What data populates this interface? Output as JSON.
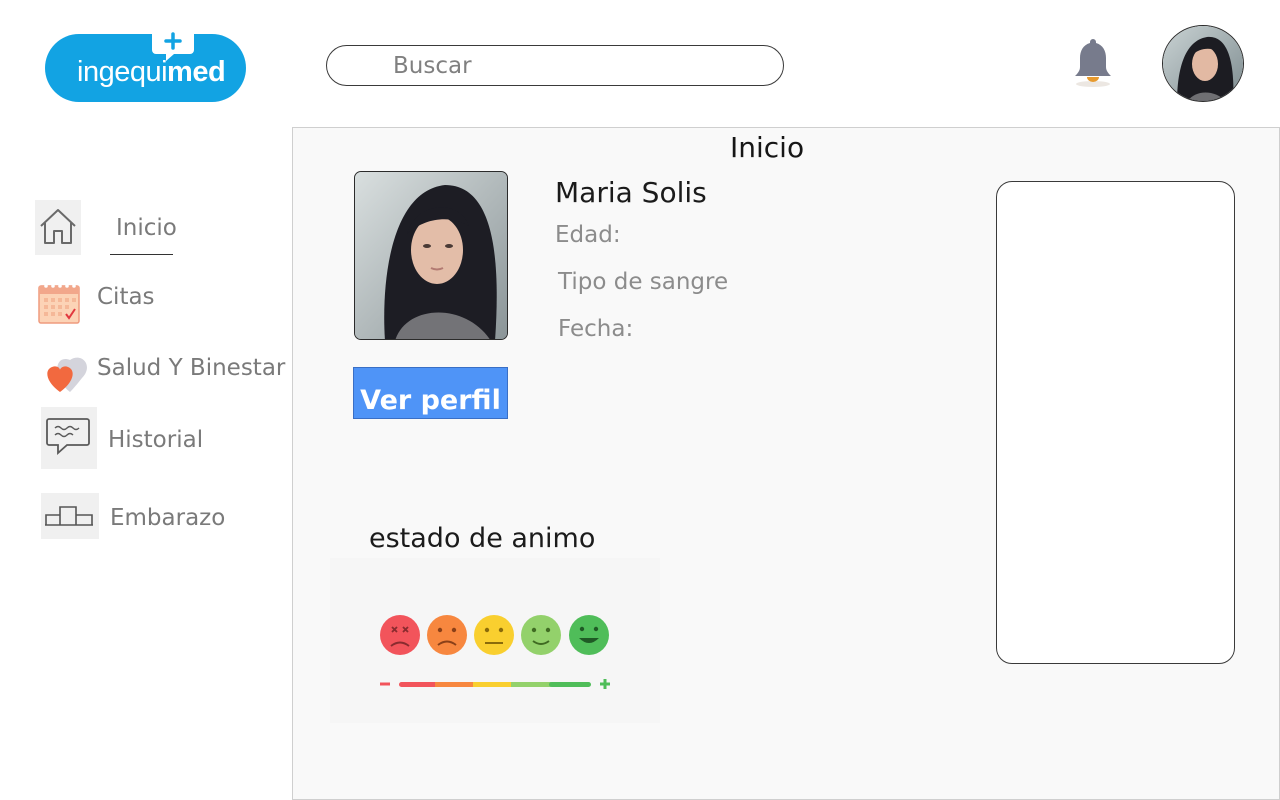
{
  "brand": {
    "name_light": "ingequi",
    "name_bold": "med",
    "color": "#12a3e3"
  },
  "search": {
    "placeholder": "Buscar"
  },
  "header": {
    "notification_icon": "bell-icon",
    "avatar": "user-avatar"
  },
  "sidebar": {
    "items": [
      {
        "label": "Inicio",
        "icon": "home-icon",
        "active": true
      },
      {
        "label": "Citas",
        "icon": "calendar-icon"
      },
      {
        "label": "Salud Y Binestar",
        "icon": "heart-icon"
      },
      {
        "label": "Historial",
        "icon": "chat-bubble-icon"
      },
      {
        "label": "Embarazo",
        "icon": "podium-icon"
      }
    ]
  },
  "main": {
    "title": "Inicio",
    "patient": {
      "name": "Maria Solis",
      "age_label": "Edad:",
      "blood_type_label": "Tipo de sangre",
      "date_label": "Fecha:"
    },
    "profile_button": "Ver perfil",
    "mood": {
      "title": "estado de animo",
      "faces": [
        "very-sad-face-icon",
        "sad-face-icon",
        "neutral-face-icon",
        "happy-face-icon",
        "very-happy-face-icon"
      ],
      "colors": [
        "#f2545b",
        "#f7873f",
        "#f9cf2f",
        "#93d16b",
        "#4fbd59"
      ]
    }
  }
}
